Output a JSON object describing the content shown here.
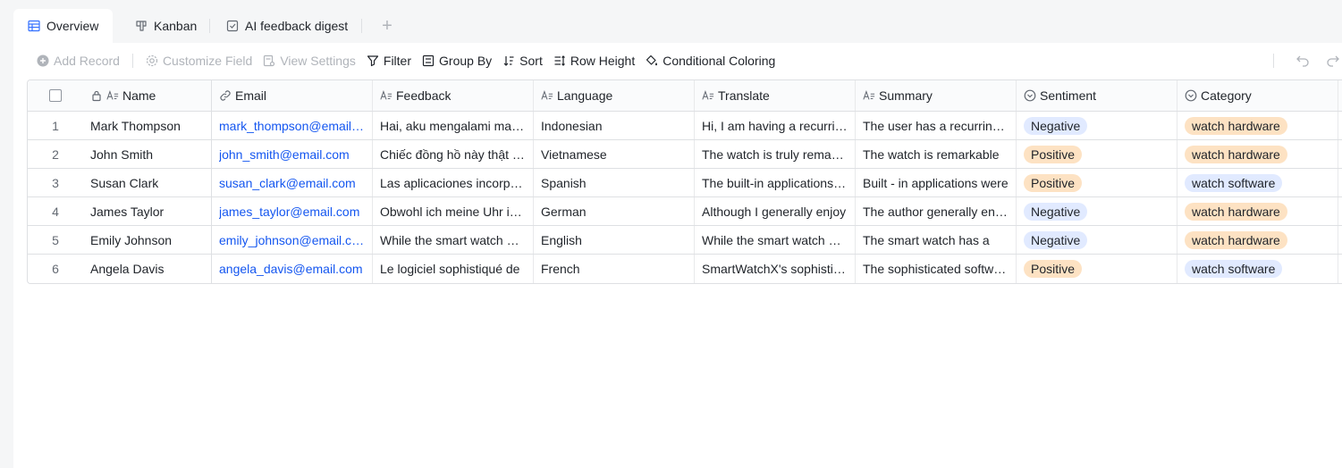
{
  "tabs": [
    {
      "label": "Overview",
      "icon": "grid-table-icon",
      "active": true
    },
    {
      "label": "Kanban",
      "icon": "kanban-icon",
      "active": false
    },
    {
      "label": "AI feedback digest",
      "icon": "form-check-icon",
      "active": false
    }
  ],
  "toolbar": {
    "add_record": "Add Record",
    "customize_field": "Customize Field",
    "view_settings": "View Settings",
    "filter": "Filter",
    "group_by": "Group By",
    "sort": "Sort",
    "row_height": "Row Height",
    "conditional_coloring": "Conditional Coloring"
  },
  "columns": {
    "name": "Name",
    "email": "Email",
    "feedback": "Feedback",
    "language": "Language",
    "translate": "Translate",
    "summary": "Summary",
    "sentiment": "Sentiment",
    "category": "Category"
  },
  "colors": {
    "link": "#1456f0",
    "tag_negative_bg": "#e1eaff",
    "tag_positive_bg": "#fde2c3",
    "tag_hardware_bg": "#fde2c3",
    "tag_software_bg": "#e1eaff"
  },
  "rows": [
    {
      "idx": "1",
      "name": "Mark Thompson",
      "email": "mark_thompson@email.com",
      "feedback": "Hai, aku mengalami masalah",
      "language": "Indonesian",
      "translate": "Hi, I am having a recurring issue",
      "summary": "The user has a recurring issue",
      "sentiment": "Negative",
      "category": "watch hardware"
    },
    {
      "idx": "2",
      "name": "John Smith",
      "email": "john_smith@email.com",
      "feedback": "Chiếc đồng hồ này thật tuyệt",
      "language": "Vietnamese",
      "translate": "The watch is truly remarkable",
      "summary": "The watch is remarkable",
      "sentiment": "Positive",
      "category": "watch hardware"
    },
    {
      "idx": "3",
      "name": "Susan Clark",
      "email": "susan_clark@email.com",
      "feedback": "Las aplicaciones incorporadas",
      "language": "Spanish",
      "translate": "The built-in applications are",
      "summary": "Built - in applications were",
      "sentiment": "Positive",
      "category": "watch software"
    },
    {
      "idx": "4",
      "name": "James Taylor",
      "email": "james_taylor@email.com",
      "feedback": "Obwohl ich meine Uhr im Allgemeinen",
      "language": "German",
      "translate": "Although I generally enjoy",
      "summary": "The author generally enjoys",
      "sentiment": "Negative",
      "category": "watch hardware"
    },
    {
      "idx": "5",
      "name": "Emily Johnson",
      "email": "emily_johnson@email.com",
      "feedback": "While the smart watch does",
      "language": "English",
      "translate": "While the smart watch does",
      "summary": "The smart watch has a",
      "sentiment": "Negative",
      "category": "watch hardware"
    },
    {
      "idx": "6",
      "name": "Angela Davis",
      "email": "angela_davis@email.com",
      "feedback": "Le logiciel sophistiqué de",
      "language": "French",
      "translate": "SmartWatchX's sophisticated",
      "summary": "The sophisticated software",
      "sentiment": "Positive",
      "category": "watch software"
    }
  ]
}
